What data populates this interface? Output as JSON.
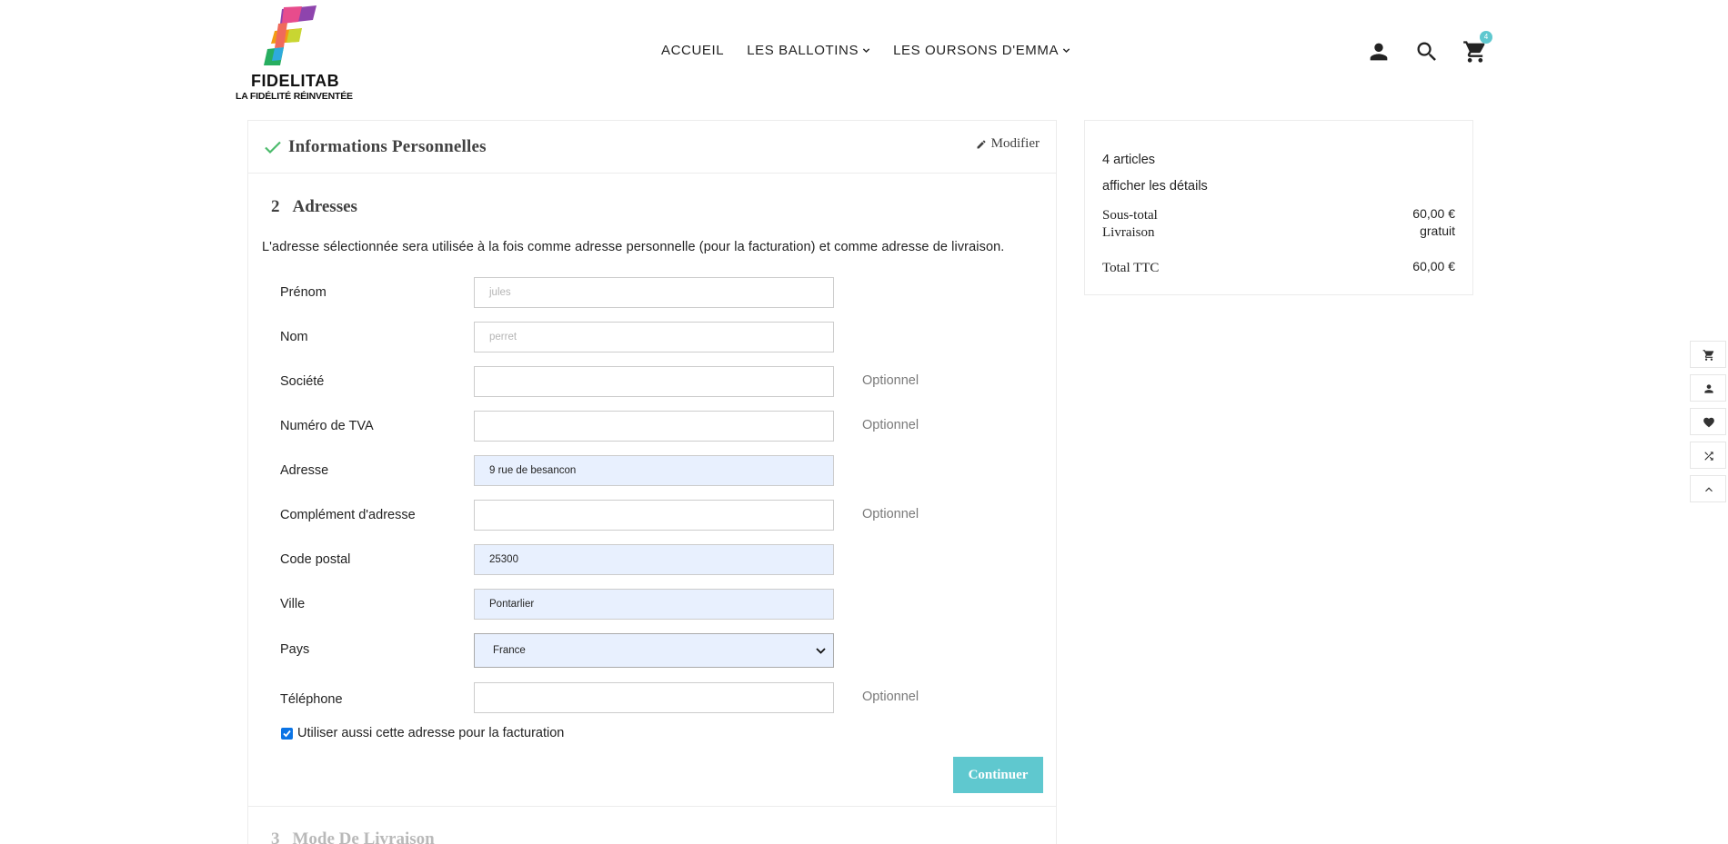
{
  "brand": {
    "name_bold": "FIDELI",
    "name_rest": "TAB",
    "tagline": "LA FIDÉLITÉ RÉINVENTÉE"
  },
  "nav": {
    "items": [
      {
        "label": "ACCUEIL",
        "has_dropdown": false
      },
      {
        "label": "LES BALLOTINS",
        "has_dropdown": true
      },
      {
        "label": "LES OURSONS D'EMMA",
        "has_dropdown": true
      }
    ]
  },
  "header_icons": {
    "account": "person-icon",
    "search": "search-icon",
    "cart": "cart-icon",
    "cart_count": "4"
  },
  "checkout": {
    "step1": {
      "title": "Informations Personnelles",
      "edit_label": "Modifier"
    },
    "step2": {
      "number": "2",
      "title": "Adresses",
      "intro": "L'adresse sélectionnée sera utilisée à la fois comme adresse personnelle (pour la facturation) et comme adresse de livraison.",
      "fields": [
        {
          "label": "Prénom",
          "value": "",
          "placeholder": "jules",
          "optional": ""
        },
        {
          "label": "Nom",
          "value": "",
          "placeholder": "perret",
          "optional": ""
        },
        {
          "label": "Société",
          "value": "",
          "placeholder": "",
          "optional": "Optionnel"
        },
        {
          "label": "Numéro de TVA",
          "value": "",
          "placeholder": "",
          "optional": "Optionnel"
        },
        {
          "label": "Adresse",
          "value": "9 rue de besancon",
          "placeholder": "",
          "optional": ""
        },
        {
          "label": "Complément d'adresse",
          "value": "",
          "placeholder": "",
          "optional": "Optionnel"
        },
        {
          "label": "Code postal",
          "value": "25300",
          "placeholder": "",
          "optional": ""
        },
        {
          "label": "Ville",
          "value": "Pontarlier",
          "placeholder": "",
          "optional": ""
        },
        {
          "label": "Pays",
          "value": "France",
          "placeholder": "",
          "optional": ""
        },
        {
          "label": "Téléphone",
          "value": "",
          "placeholder": "",
          "optional": "Optionnel"
        }
      ],
      "billing_checkbox": {
        "label": "Utiliser aussi cette adresse pour la facturation",
        "checked": true
      },
      "continue_label": "Continuer"
    },
    "step3": {
      "number": "3",
      "title": "Mode De Livraison"
    }
  },
  "summary": {
    "count": "4 articles",
    "details_link": "afficher les détails",
    "subtotal_label": "Sous-total",
    "subtotal_value": "60,00 €",
    "shipping_label": "Livraison",
    "shipping_value": "gratuit",
    "total_label": "Total TTC",
    "total_value": "60,00 €"
  },
  "side_toolbar": [
    "cart-icon",
    "person-icon",
    "heart-icon",
    "shuffle-icon",
    "chevron-up-icon"
  ],
  "colors": {
    "accent": "#5fc8cf",
    "autofill": "#e8f0fe",
    "check": "#4cbb6c",
    "text": "#232323"
  }
}
